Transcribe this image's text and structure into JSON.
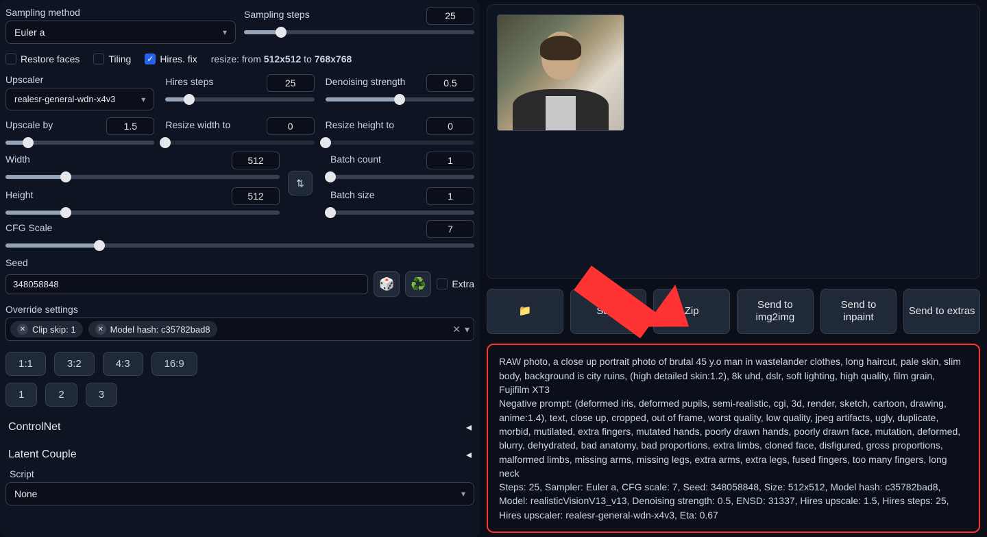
{
  "sampling": {
    "method_label": "Sampling method",
    "method_value": "Euler a",
    "steps_label": "Sampling steps",
    "steps_value": "25",
    "steps_percent": 16
  },
  "checks": {
    "restore_faces": "Restore faces",
    "tiling": "Tiling",
    "hires_fix": "Hires. fix",
    "resize_prefix": "resize: from ",
    "resize_from": "512x512",
    "resize_to_word": " to ",
    "resize_to": "768x768"
  },
  "hires": {
    "upscaler_label": "Upscaler",
    "upscaler_value": "realesr-general-wdn-x4v3",
    "hires_steps_label": "Hires steps",
    "hires_steps_value": "25",
    "hires_steps_percent": 16,
    "denoise_label": "Denoising strength",
    "denoise_value": "0.5",
    "denoise_percent": 50,
    "upscale_by_label": "Upscale by",
    "upscale_by_value": "1.5",
    "upscale_by_percent": 15,
    "resize_w_label": "Resize width to",
    "resize_w_value": "0",
    "resize_w_percent": 0,
    "resize_h_label": "Resize height to",
    "resize_h_value": "0",
    "resize_h_percent": 0
  },
  "dims": {
    "width_label": "Width",
    "width_value": "512",
    "width_percent": 22,
    "height_label": "Height",
    "height_value": "512",
    "height_percent": 22,
    "batch_count_label": "Batch count",
    "batch_count_value": "1",
    "batch_count_percent": 0,
    "batch_size_label": "Batch size",
    "batch_size_value": "1",
    "batch_size_percent": 0
  },
  "cfg": {
    "label": "CFG Scale",
    "value": "7",
    "percent": 20
  },
  "seed": {
    "label": "Seed",
    "value": "348058848",
    "extra_label": "Extra"
  },
  "override": {
    "label": "Override settings",
    "tags": [
      "Clip skip: 1",
      "Model hash: c35782bad8"
    ]
  },
  "ratios": [
    "1:1",
    "3:2",
    "4:3",
    "16:9"
  ],
  "nums": [
    "1",
    "2",
    "3"
  ],
  "accordions": {
    "controlnet": "ControlNet",
    "latent_couple": "Latent Couple"
  },
  "script": {
    "label": "Script",
    "value": "None"
  },
  "actions": {
    "folder": "📁",
    "save": "Save",
    "zip": "Zip",
    "send_img2img": "Send to img2img",
    "send_inpaint": "Send to inpaint",
    "send_extras": "Send to extras"
  },
  "info": {
    "prompt": "RAW photo, a close up portrait photo of brutal 45 y.o man in wastelander clothes, long haircut, pale skin, slim body, background is city ruins, (high detailed skin:1.2), 8k uhd, dslr, soft lighting, high quality, film grain, Fujifilm XT3",
    "neg_label": "Negative prompt: ",
    "neg_prompt": "(deformed iris, deformed pupils, semi-realistic, cgi, 3d, render, sketch, cartoon, drawing, anime:1.4), text, close up, cropped, out of frame, worst quality, low quality, jpeg artifacts, ugly, duplicate, morbid, mutilated, extra fingers, mutated hands, poorly drawn hands, poorly drawn face, mutation, deformed, blurry, dehydrated, bad anatomy, bad proportions, extra limbs, cloned face, disfigured, gross proportions, malformed limbs, missing arms, missing legs, extra arms, extra legs, fused fingers, too many fingers, long neck",
    "params": "Steps: 25, Sampler: Euler a, CFG scale: 7, Seed: 348058848, Size: 512x512, Model hash: c35782bad8, Model: realisticVisionV13_v13, Denoising strength: 0.5, ENSD: 31337, Hires upscale: 1.5, Hires steps: 25, Hires upscaler: realesr-general-wdn-x4v3, Eta: 0.67"
  }
}
